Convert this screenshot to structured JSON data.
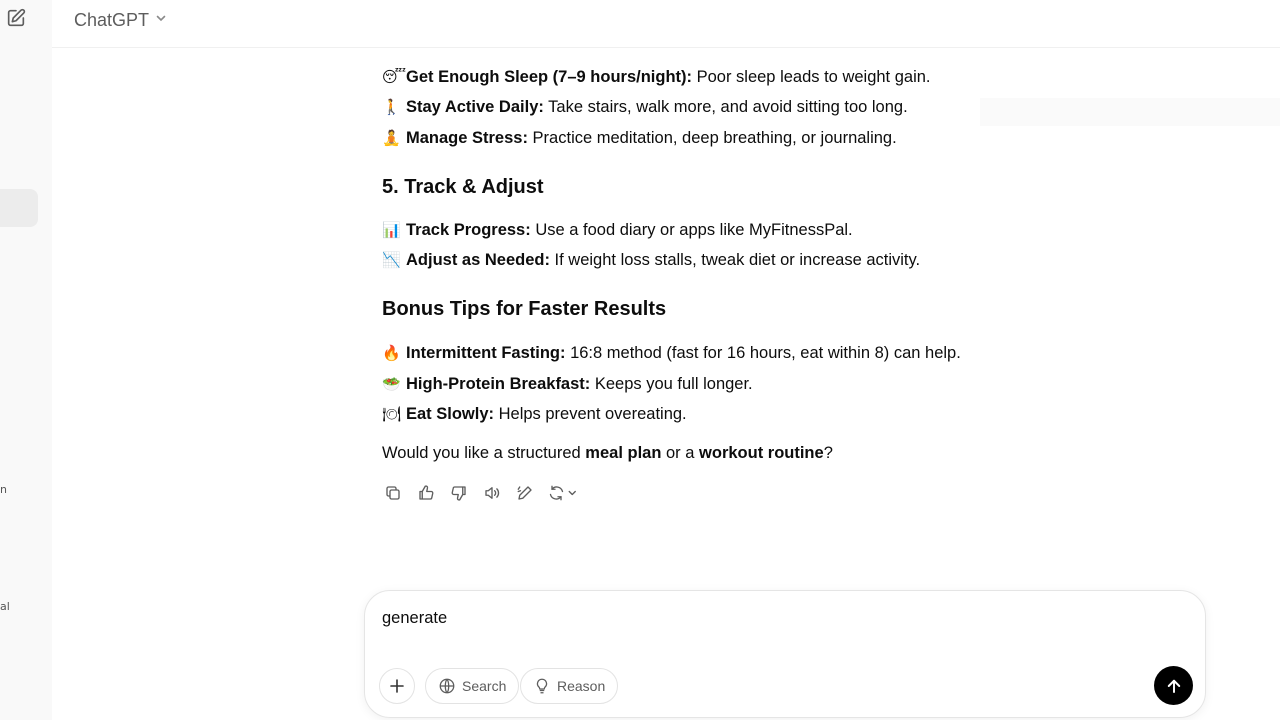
{
  "app": {
    "model_name": "ChatGPT"
  },
  "rail": {
    "clip1": "n",
    "clip2": "al"
  },
  "message": {
    "lines1": [
      {
        "emoji": "😴",
        "bold": "Get Enough Sleep (7–9 hours/night):",
        "text": " Poor sleep leads to weight gain."
      },
      {
        "emoji": "🚶",
        "bold": "Stay Active Daily:",
        "text": " Take stairs, walk more, and avoid sitting too long."
      },
      {
        "emoji": "🧘",
        "bold": "Manage Stress:",
        "text": " Practice meditation, deep breathing, or journaling."
      }
    ],
    "heading1": "5. Track & Adjust",
    "lines2": [
      {
        "emoji": "📊",
        "bold": "Track Progress:",
        "text": " Use a food diary or apps like MyFitnessPal."
      },
      {
        "emoji": "📉",
        "bold": "Adjust as Needed:",
        "text": " If weight loss stalls, tweak diet or increase activity."
      }
    ],
    "heading2": "Bonus Tips for Faster Results",
    "lines3": [
      {
        "emoji": "🔥",
        "bold": "Intermittent Fasting:",
        "text": " 16:8 method (fast for 16 hours, eat within 8) can help."
      },
      {
        "emoji": "🥗",
        "bold": "High-Protein Breakfast:",
        "text": " Keeps you full longer."
      },
      {
        "emoji": "🍽",
        "bold": "Eat Slowly:",
        "text": " Helps prevent overeating."
      }
    ],
    "closing": {
      "part1": "Would you like a structured ",
      "bold1": "meal plan",
      "part2": " or a ",
      "bold2": "workout routine",
      "part3": "?"
    }
  },
  "composer": {
    "input_value": "generate",
    "search_label": "Search",
    "reason_label": "Reason"
  }
}
